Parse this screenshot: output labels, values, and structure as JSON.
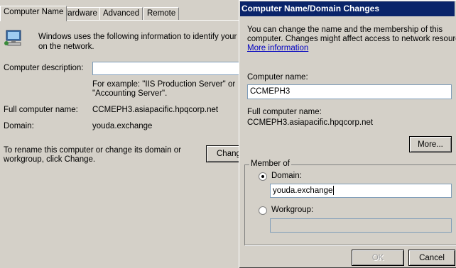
{
  "system_properties": {
    "tabs": [
      {
        "label": "Computer Name"
      },
      {
        "label": "Hardware"
      },
      {
        "label": "Advanced"
      },
      {
        "label": "Remote"
      }
    ],
    "intro_line1": "Windows uses the following information to identify your co",
    "intro_line2": "on the network.",
    "description_label": "Computer description:",
    "description_value": "",
    "example_line1": "For example: \"IIS Production Server\" or",
    "example_line2": "\"Accounting Server\".",
    "full_name_label": "Full computer name:",
    "full_name_value": "CCMEPH3.asiapacific.hpqcorp.net",
    "domain_label": "Domain:",
    "domain_value": "youda.exchange",
    "rename_line1": "To rename this computer or change its domain or",
    "rename_line2": "workgroup, click Change.",
    "change_button": "Change"
  },
  "dialog": {
    "title": "Computer Name/Domain Changes",
    "info_line1": "You can change the name and the membership of this",
    "info_line2": "computer. Changes might affect access to network resources",
    "more_info_link": "More information",
    "computer_name_label": "Computer name:",
    "computer_name_value": "CCMEPH3",
    "full_name_label": "Full computer name:",
    "full_name_value": "CCMEPH3.asiapacific.hpqcorp.net",
    "more_button": "More...",
    "member_of_label": "Member of",
    "domain_radio_label": "Domain:",
    "domain_value": "youda.exchange",
    "domain_selected": true,
    "workgroup_radio_label": "Workgroup:",
    "workgroup_value": "",
    "ok_button": "OK",
    "cancel_button": "Cancel"
  }
}
